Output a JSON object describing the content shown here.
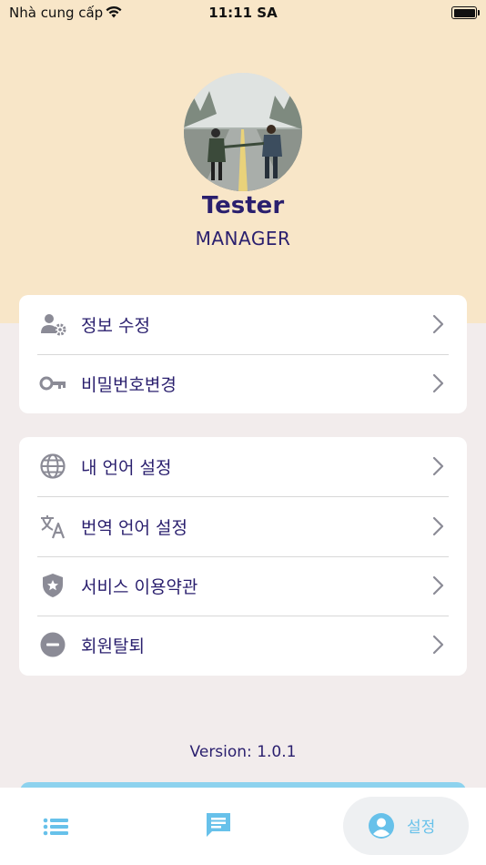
{
  "status_bar": {
    "carrier": "Nhà cung cấp",
    "time": "11:11 SA"
  },
  "profile": {
    "name": "Tester",
    "role": "MANAGER"
  },
  "menu_group_1": [
    {
      "label": "정보 수정",
      "icon": "user-gear-icon"
    },
    {
      "label": "비밀번호변경",
      "icon": "key-icon"
    }
  ],
  "menu_group_2": [
    {
      "label": "내 언어 설정",
      "icon": "globe-icon"
    },
    {
      "label": "번역 언어 설정",
      "icon": "translate-icon"
    },
    {
      "label": "서비스 이용약관",
      "icon": "shield-star-icon"
    },
    {
      "label": "회원탈퇴",
      "icon": "minus-circle-icon"
    }
  ],
  "version": "Version: 1.0.1",
  "tab_bar": {
    "settings_label": "설정"
  },
  "colors": {
    "header_bg": "#f8e6c8",
    "text": "#2a1f6e",
    "accent": "#67c1ea",
    "icon_gray": "#8b8b96"
  }
}
